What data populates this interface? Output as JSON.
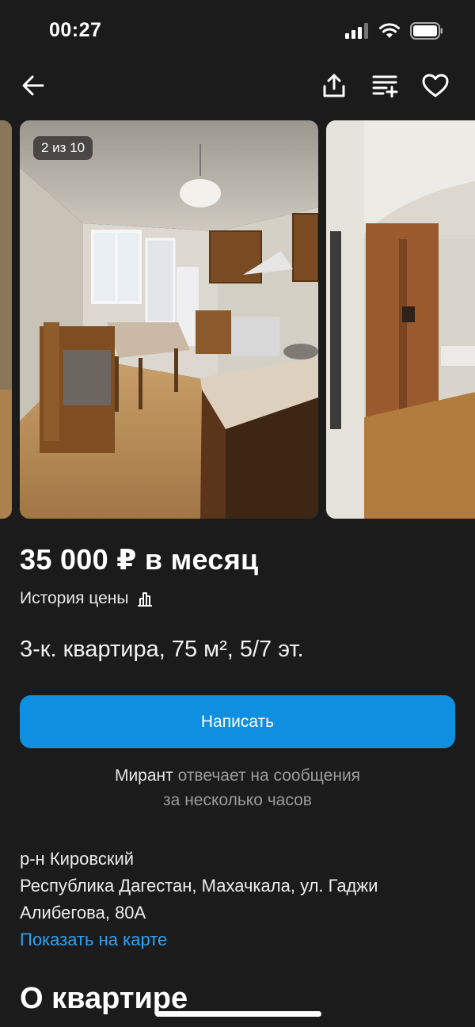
{
  "status_bar": {
    "time": "00:27",
    "icons": [
      "signal-icon",
      "wifi-icon",
      "battery-icon"
    ]
  },
  "navbar": {
    "icons": [
      "back-arrow-icon",
      "share-icon",
      "compare-icon",
      "favorite-heart-icon"
    ]
  },
  "gallery": {
    "counter": "2 из 10",
    "current": 2,
    "total": 10
  },
  "listing": {
    "price": "35 000 ₽ в месяц",
    "price_history_label": "История цены",
    "title": "3-к. квартира, 75 м², 5/7 эт."
  },
  "contact": {
    "button_label": "Написать",
    "seller_name": "Мирант",
    "reply_text_1": " отвечает на сообщения",
    "reply_text_2": "за несколько часов"
  },
  "address": {
    "district": "р-н Кировский",
    "full": "Республика Дагестан, Махачкала, ул. Гаджи Алибегова, 80А",
    "map_link": "Показать на карте"
  },
  "section": {
    "about_title": "О квартире"
  },
  "colors": {
    "background": "#1b1b1c",
    "accent_button": "#0e8fe0",
    "link": "#2aa3f5"
  }
}
